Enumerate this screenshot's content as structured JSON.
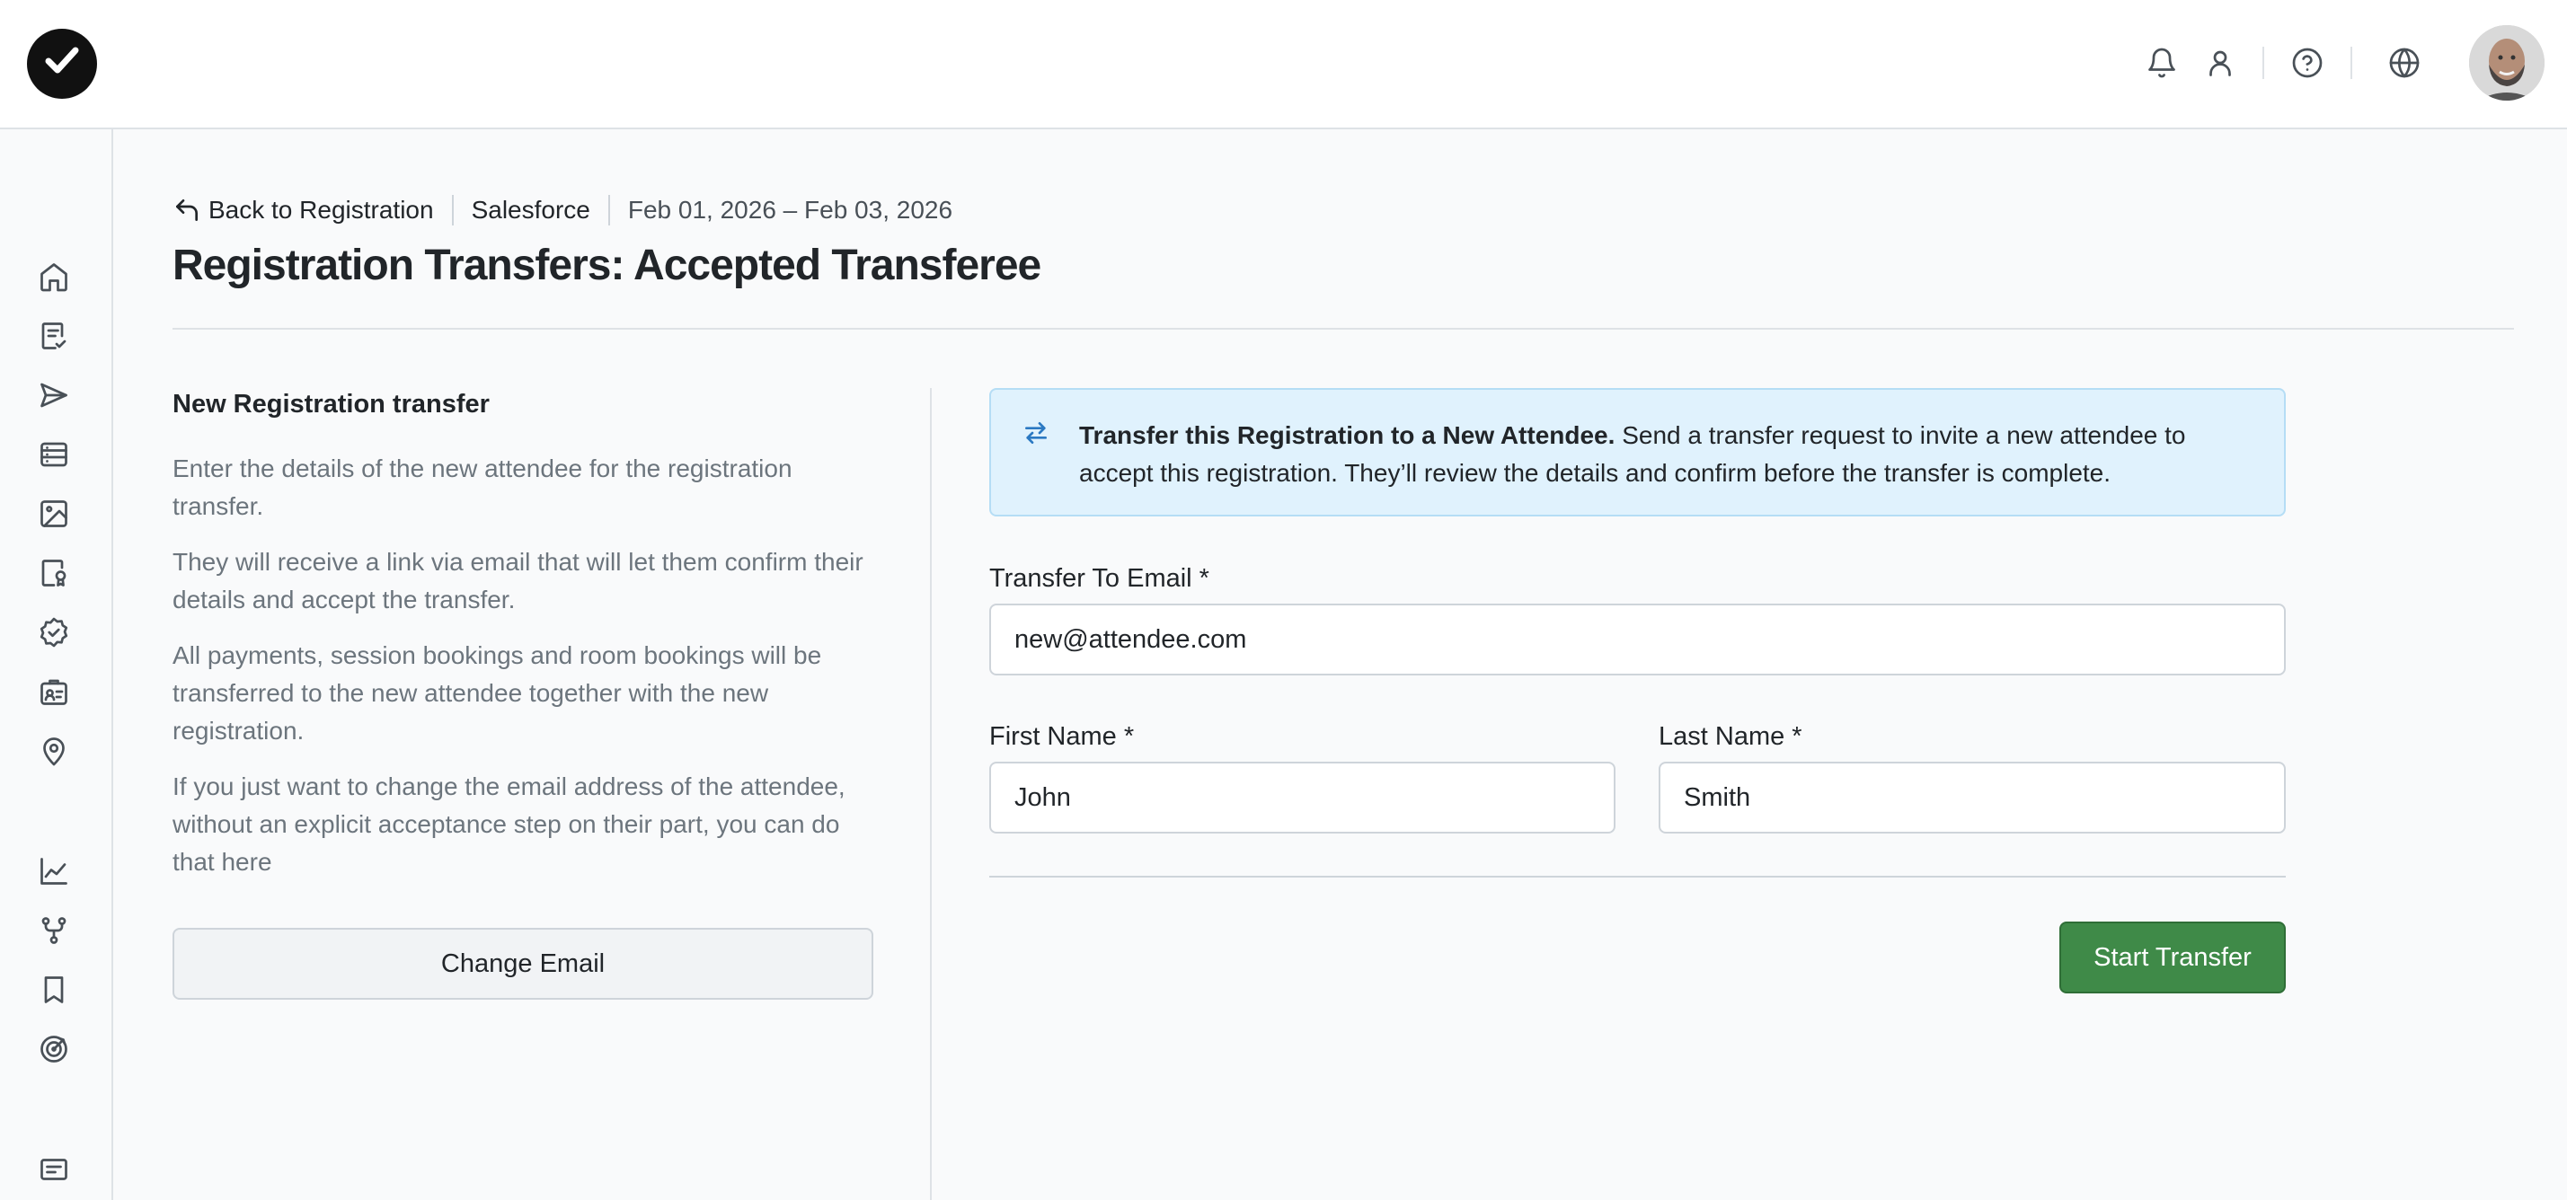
{
  "header": {
    "icons": [
      "check-logo-icon",
      "bell-icon",
      "user-icon",
      "help-icon",
      "globe-icon",
      "avatar"
    ]
  },
  "sidebar": {
    "icons": [
      "home-icon",
      "checklist-icon",
      "send-icon",
      "list-icon",
      "image-icon",
      "badge-icon",
      "verified-icon",
      "id-card-icon",
      "location-icon",
      "chart-icon",
      "branch-icon",
      "bookmark-icon",
      "target-icon",
      "message-icon"
    ]
  },
  "breadcrumb": {
    "back_label": "Back to Registration",
    "event": "Salesforce",
    "dates": "Feb 01, 2026 – Feb 03, 2026"
  },
  "page": {
    "title": "Registration Transfers: Accepted Transferee"
  },
  "left": {
    "section_title": "New Registration transfer",
    "paragraphs": [
      "Enter the details of the new attendee for the registration transfer.",
      "They will receive a link via email that will let them confirm their details and accept the transfer.",
      "All payments, session bookings and room bookings will be transferred to the new attendee together with the new registration.",
      "If you just want to change the email address of the attendee, without an explicit acceptance step on their part, you can do that here"
    ],
    "change_email_label": "Change Email"
  },
  "alert": {
    "title": "Transfer this Registration to a New Attendee.",
    "body": " Send a transfer request to invite a new attendee to accept this registration. They’ll review the details and confirm before the transfer is complete."
  },
  "form": {
    "email_label": "Transfer To Email *",
    "email_value": "new@attendee.com",
    "first_name_label": "First Name *",
    "first_name_value": "John",
    "last_name_label": "Last Name *",
    "last_name_value": "Smith",
    "submit_label": "Start Transfer"
  },
  "colors": {
    "primary_button": "#3f8a48",
    "alert_background": "#e0f2fd",
    "alert_icon": "#2b79c2"
  }
}
